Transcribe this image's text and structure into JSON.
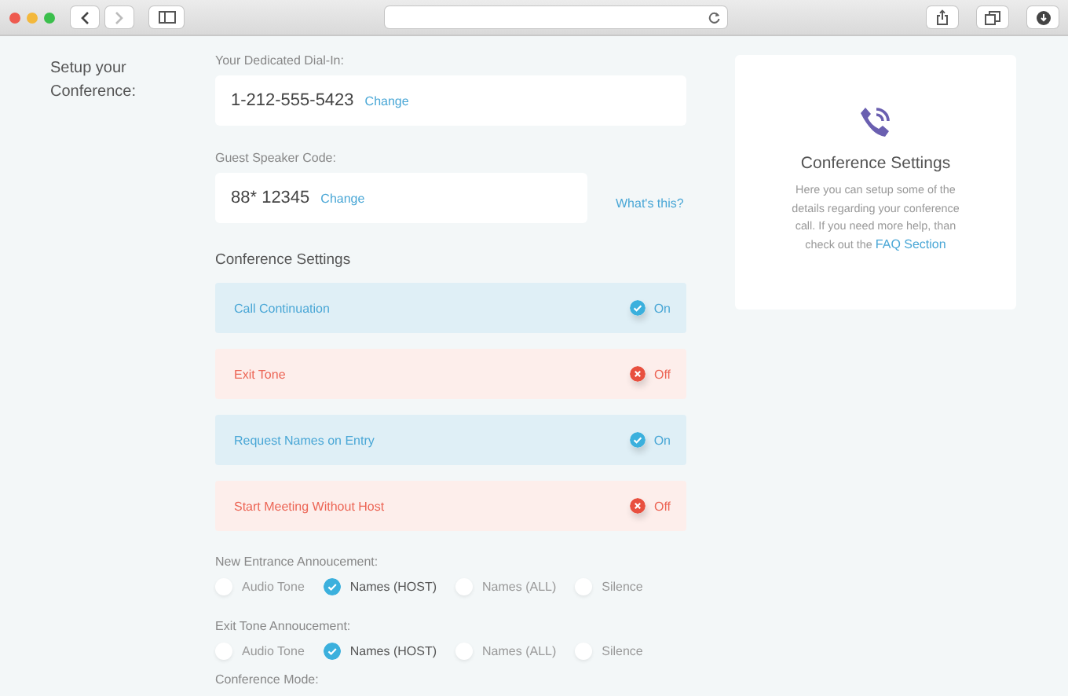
{
  "section_label": "Setup your Conference:",
  "dial_in": {
    "label": "Your Dedicated Dial-In:",
    "value": "1-212-555-5423",
    "action": "Change"
  },
  "guest_code": {
    "label": "Guest Speaker Code:",
    "value": "88* 12345",
    "action": "Change",
    "help_link": "What's this?"
  },
  "settings": {
    "title": "Conference Settings",
    "items": [
      {
        "label": "Call Continuation",
        "on": true,
        "state_text": "On"
      },
      {
        "label": "Exit Tone",
        "on": false,
        "state_text": "Off"
      },
      {
        "label": "Request Names on Entry",
        "on": true,
        "state_text": "On"
      },
      {
        "label": "Start Meeting Without Host",
        "on": false,
        "state_text": "Off"
      }
    ]
  },
  "announcements": [
    {
      "label": "New Entrance Annoucement:",
      "options": [
        {
          "label": "Audio Tone",
          "selected": false
        },
        {
          "label": "Names (HOST)",
          "selected": true
        },
        {
          "label": "Names (ALL)",
          "selected": false
        },
        {
          "label": "Silence",
          "selected": false
        }
      ]
    },
    {
      "label": "Exit Tone Annoucement:",
      "options": [
        {
          "label": "Audio Tone",
          "selected": false
        },
        {
          "label": "Names (HOST)",
          "selected": true
        },
        {
          "label": "Names (ALL)",
          "selected": false
        },
        {
          "label": "Silence",
          "selected": false
        }
      ]
    }
  ],
  "conference_mode": {
    "label": "Conference Mode:"
  },
  "info_card": {
    "title": "Conference Settings",
    "text": "Here you can setup some of the details regarding your conference call. If you need more help, than check out the",
    "link": "FAQ Section"
  }
}
